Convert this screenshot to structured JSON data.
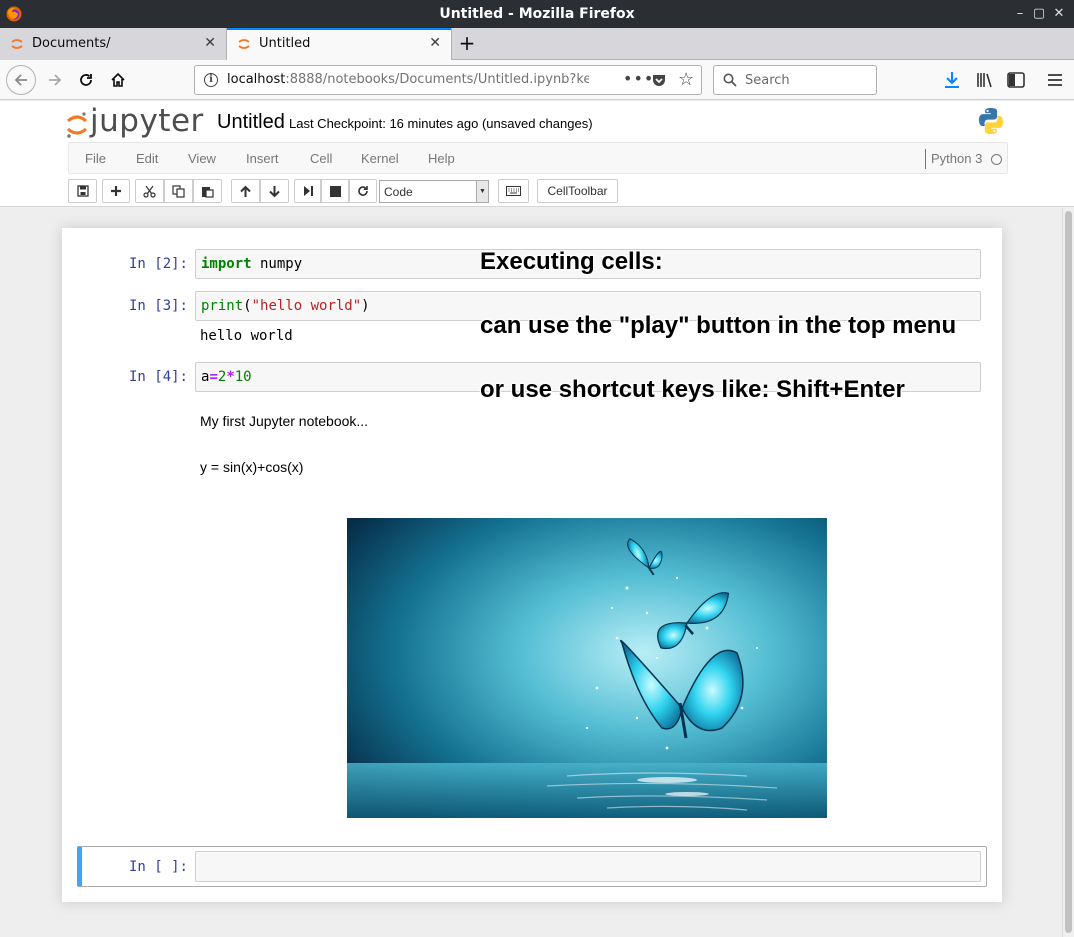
{
  "window": {
    "title": "Untitled - Mozilla Firefox",
    "controls": [
      "–",
      "▢",
      "✕"
    ]
  },
  "tabs": [
    {
      "label": "Documents/",
      "active": false
    },
    {
      "label": "Untitled",
      "active": true
    }
  ],
  "navbar": {
    "url_host": "localhost",
    "url_rest": ":8888/notebooks/Documents/Untitled.ipynb?ke",
    "search_placeholder": "Search",
    "more_label": "•••"
  },
  "jupyter": {
    "logo_text": "jupyter",
    "notebook_name": "Untitled",
    "checkpoint": "Last Checkpoint: 16 minutes ago (unsaved changes)",
    "menu": [
      "File",
      "Edit",
      "View",
      "Insert",
      "Cell",
      "Kernel",
      "Help"
    ],
    "kernel_name": "Python 3",
    "toolbar": {
      "cell_type": "Code",
      "celltoolbar_label": "CellToolbar"
    }
  },
  "cells": {
    "c1": {
      "prompt": "In [2]:",
      "kw": "import",
      "rest": " numpy"
    },
    "c2": {
      "prompt": "In [3]:",
      "fn": "print",
      "p1": "(",
      "str": "\"hello world\"",
      "p2": ")",
      "output": "hello world"
    },
    "c3": {
      "prompt": "In [4]:",
      "var": "a",
      "eq": "=",
      "n1": "2",
      "op": "*",
      "n2": "10"
    },
    "markdown": {
      "line1": "My first Jupyter notebook...",
      "line2": "y = sin(x)+cos(x)"
    },
    "empty": {
      "prompt": "In [ ]:"
    }
  },
  "annotation": {
    "line1": "Executing cells:",
    "line2": "can use the \"play\" button in the top menu",
    "line3": "or use shortcut keys like: Shift+Enter"
  },
  "colors": {
    "prompt_blue": "#303f9f",
    "selected_cell_border": "#42a5f5",
    "jupyter_orange": "#f37726",
    "firefox_accent": "#0a84ff"
  }
}
